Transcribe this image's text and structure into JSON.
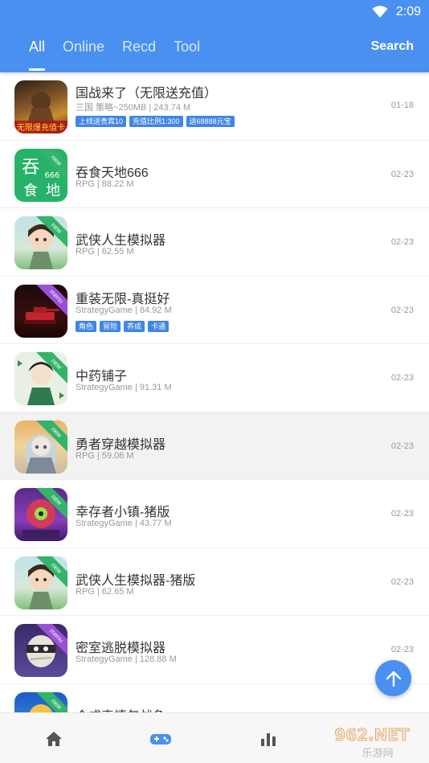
{
  "status_bar": {
    "time": "2:09"
  },
  "tabs": [
    {
      "label": "All",
      "active": true
    },
    {
      "label": "Online",
      "active": false
    },
    {
      "label": "Recd",
      "active": false
    },
    {
      "label": "Tool",
      "active": false
    }
  ],
  "search_label": "Search",
  "colors": {
    "primary": "#4a90f0",
    "tag_bg": "#3f86e6",
    "new_ribbon": "#34b36a",
    "menu_ribbon": "#9b4fd6"
  },
  "apps": [
    {
      "title": "国战来了（无限送充值）",
      "meta": "三国 策略~250MB | 243.74 M",
      "date": "01-18",
      "tags": [
        "上线送贵宾10",
        "充值比例1:300",
        "送68888元宝"
      ],
      "ribbon": ""
    },
    {
      "title": "吞食天地666",
      "meta": "RPG | 88.22 M",
      "date": "02-23",
      "tags": [],
      "ribbon": "new"
    },
    {
      "title": "武侠人生模拟器",
      "meta": "RPG | 62.55 M",
      "date": "02-23",
      "tags": [],
      "ribbon": "new"
    },
    {
      "title": "重装无限-真挺好",
      "meta": "StrategyGame | 84.92 M",
      "date": "02-23",
      "tags": [
        "角色",
        "冒险",
        "养成",
        "卡通"
      ],
      "ribbon": "menu"
    },
    {
      "title": "中药铺子",
      "meta": "StrategyGame | 91.31 M",
      "date": "02-23",
      "tags": [],
      "ribbon": "new"
    },
    {
      "title": "勇者穿越模拟器",
      "meta": "RPG | 59.06 M",
      "date": "02-23",
      "tags": [],
      "ribbon": "new"
    },
    {
      "title": "幸存者小镇-猪版",
      "meta": "StrategyGame | 43.77 M",
      "date": "02-23",
      "tags": [],
      "ribbon": "new"
    },
    {
      "title": "武侠人生模拟器-猪版",
      "meta": "RPG | 62.65 M",
      "date": "02-23",
      "tags": [],
      "ribbon": "new"
    },
    {
      "title": "密室逃脱模拟器",
      "meta": "StrategyGame | 128.88 M",
      "date": "02-23",
      "tags": [],
      "ribbon": "menu"
    },
    {
      "title": "合成表情包战争",
      "meta": "",
      "date": "",
      "tags": [],
      "ribbon": "new"
    }
  ],
  "icon_ribbon_text": {
    "new": "new",
    "menu": "menu"
  },
  "bottom_nav": [
    "home-icon",
    "gamepad-icon",
    "chart-icon"
  ],
  "watermark": {
    "text_top": "962.NET",
    "text_bottom": "乐游网"
  }
}
